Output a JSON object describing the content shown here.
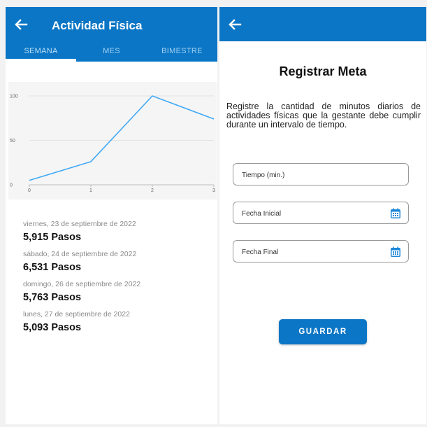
{
  "left_screen": {
    "title": "Actividad Física",
    "tabs": [
      {
        "label": "SEMANA",
        "active": true
      },
      {
        "label": "MES",
        "active": false
      },
      {
        "label": "BIMESTRE",
        "active": false
      }
    ],
    "entries": [
      {
        "date": "viernes, 23 de septiembre de 2022",
        "steps": "5,915 Pasos"
      },
      {
        "date": "sábado, 24 de septiembre de 2022",
        "steps": "6,531 Pasos"
      },
      {
        "date": "domingo, 26 de septiembre de 2022",
        "steps": "5,763 Pasos"
      },
      {
        "date": "lunes, 27 de septiembre de 2022",
        "steps": "5,093 Pasos"
      }
    ]
  },
  "chart_data": {
    "type": "line",
    "x": [
      0,
      1,
      2,
      3
    ],
    "series": [
      {
        "values": [
          5,
          26,
          100,
          74
        ]
      }
    ],
    "xlim": [
      0,
      3
    ],
    "ylim": [
      0,
      100
    ],
    "x_ticks": [
      0,
      1,
      2,
      3
    ],
    "y_ticks": [
      0,
      50,
      100
    ],
    "grid": true,
    "line_color": "#3fa9f5"
  },
  "right_screen": {
    "title": "Registrar Meta",
    "description": "Registre la cantidad de minutos diarios de actividades físicas que la gestante debe cumplir durante un intervalo de tiempo.",
    "fields": {
      "time_placeholder": "Tiempo (min.)",
      "start_date_placeholder": "Fecha Inicial",
      "end_date_placeholder": "Fecha Final"
    },
    "save_label": "GUARDAR"
  },
  "icons": {
    "back": "arrow-left-icon",
    "calendar": "calendar-icon"
  },
  "colors": {
    "primary": "#0b76c5",
    "calendar": "#1e88d8"
  }
}
